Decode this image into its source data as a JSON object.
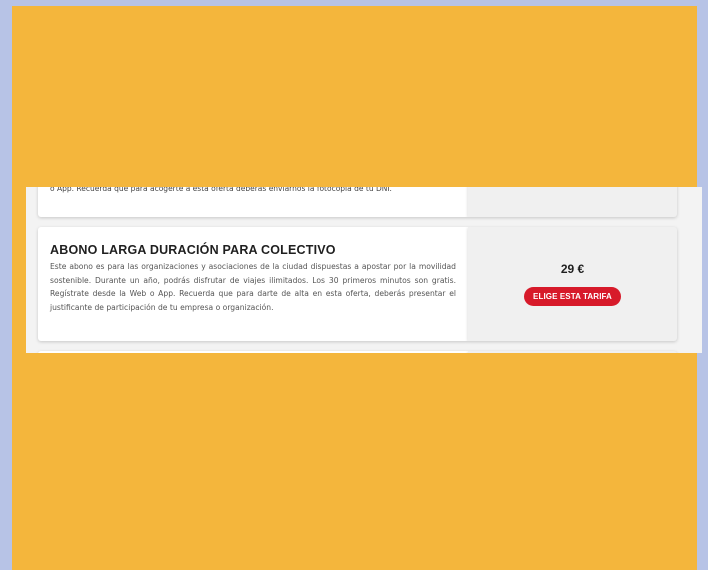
{
  "tariffs": {
    "previous": {
      "description": "o App. Recuerda que para acogerte a esta oferta deberás enviarnos la fotocopia de tu DNI."
    },
    "main": {
      "title": "ABONO LARGA DURACIÓN PARA COLECTIVO",
      "description": "Este abono es para las organizaciones y asociaciones de la ciudad dispuestas a apostar por la movilidad sostenible. Durante un año, podrás disfrutar de viajes ilimitados. Los 30 primeros minutos son gratis. Regístrate desde la Web o App. Recuerda que para darte de alta en esta oferta, deberás presentar el justificante de participación de tu empresa o organización.",
      "price": "29 €",
      "button_label": "ELIGE ESTA TARIFA"
    }
  },
  "colors": {
    "frame": "#f4b63c",
    "background": "#b7c3e6",
    "accent": "#d71a2a"
  }
}
